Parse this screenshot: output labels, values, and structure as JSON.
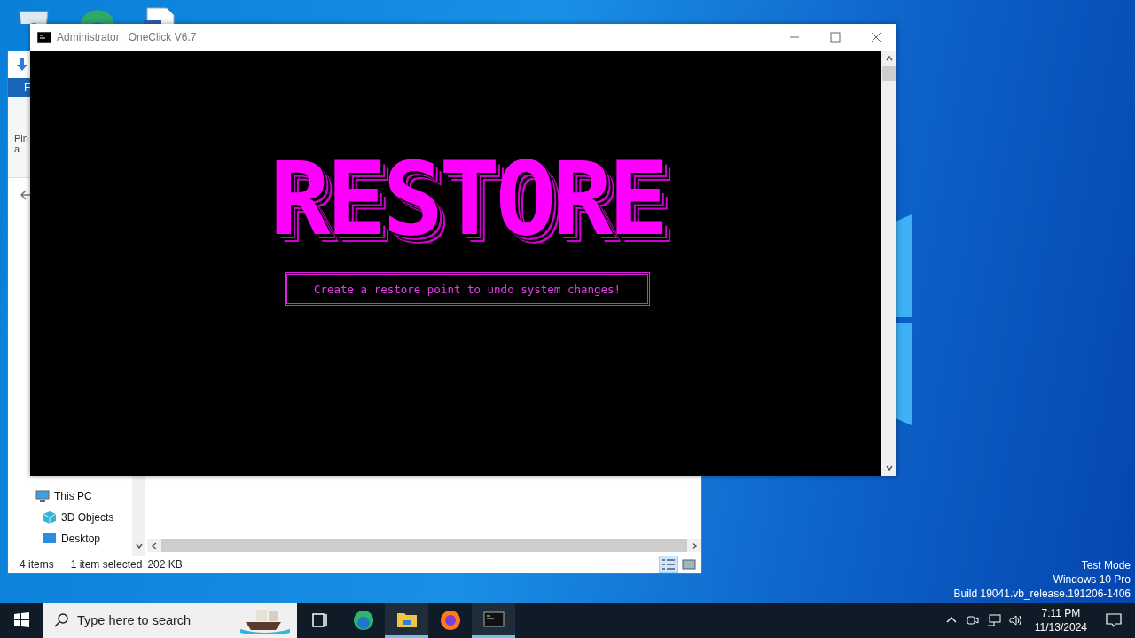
{
  "desktop": {
    "icons": [
      {
        "kind": "recycle-bin"
      },
      {
        "kind": "edge"
      },
      {
        "kind": "document"
      }
    ],
    "os_notice": [
      "Test Mode",
      "Windows 10 Pro",
      "Build 19041.vb_release.191206-1406"
    ]
  },
  "explorer": {
    "ribbon_tab": "F",
    "ribbon_labels": [
      "Pin",
      "a"
    ],
    "this_pc": {
      "label": "This PC",
      "children": [
        {
          "label": "3D Objects",
          "kind": "cube"
        },
        {
          "label": "Desktop",
          "kind": "desktop"
        }
      ]
    },
    "status": {
      "items": "4 items",
      "selected": "1 item selected",
      "size": "202 KB"
    }
  },
  "console": {
    "title": "Administrator:  OneClick V6.7",
    "banner": "RESTORE",
    "message": "Create a restore point to undo system changes!"
  },
  "taskbar": {
    "search": {
      "placeholder": "Type here to search"
    },
    "apps": [
      {
        "kind": "task-view",
        "active": false
      },
      {
        "kind": "edge",
        "active": false
      },
      {
        "kind": "folder",
        "active": true
      },
      {
        "kind": "firefox",
        "active": false
      },
      {
        "kind": "console",
        "active": true
      }
    ],
    "time": "7:11 PM",
    "date": "11/13/2024"
  }
}
